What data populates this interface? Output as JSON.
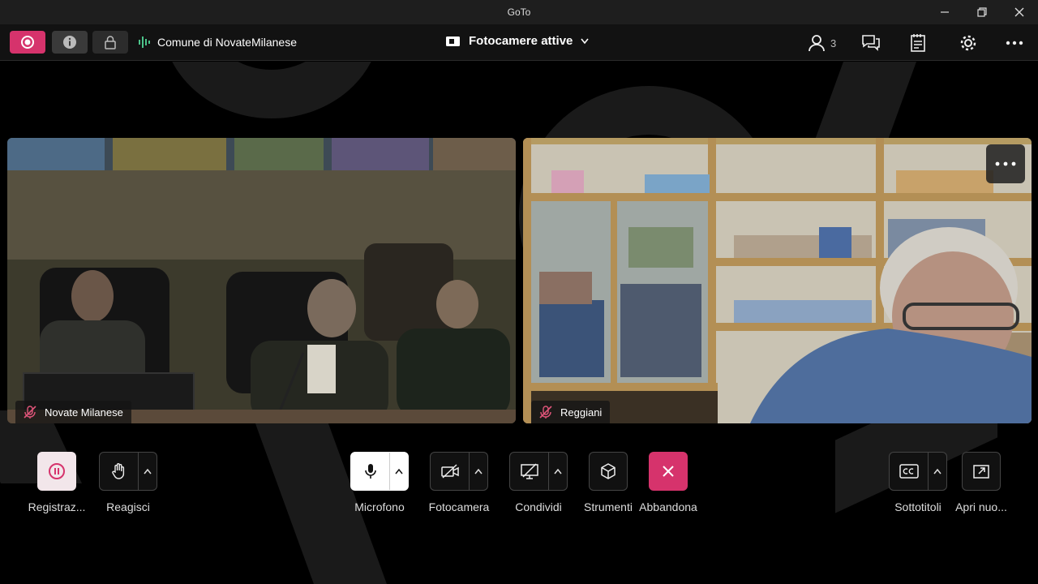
{
  "window": {
    "title": "GoTo"
  },
  "toolbar": {
    "organizer": "Comune di NovateMilanese",
    "camera_view": "Fotocamere attive",
    "participant_count": "3",
    "record_color": "#d6336c"
  },
  "tiles": [
    {
      "name": "Novate Milanese",
      "muted": true
    },
    {
      "name": "Reggiani",
      "muted": true
    }
  ],
  "controls": {
    "record": "Registraz...",
    "react": "Reagisci",
    "mic": "Microfono",
    "camera": "Fotocamera",
    "share": "Condividi",
    "tools": "Strumenti",
    "leave": "Abbandona",
    "captions": "Sottotitoli",
    "popout": "Apri nuo..."
  },
  "icons": [
    "record-icon",
    "info-icon",
    "lock-icon",
    "audio-bars-icon",
    "camera-icon",
    "chevron-down-icon",
    "people-icon",
    "chat-icon",
    "notes-icon",
    "gear-icon",
    "more-icon",
    "pause-icon",
    "hand-icon",
    "mic-icon",
    "camera-off-icon",
    "screen-share-off-icon",
    "cube-icon",
    "close-icon",
    "cc-icon",
    "popout-icon"
  ]
}
